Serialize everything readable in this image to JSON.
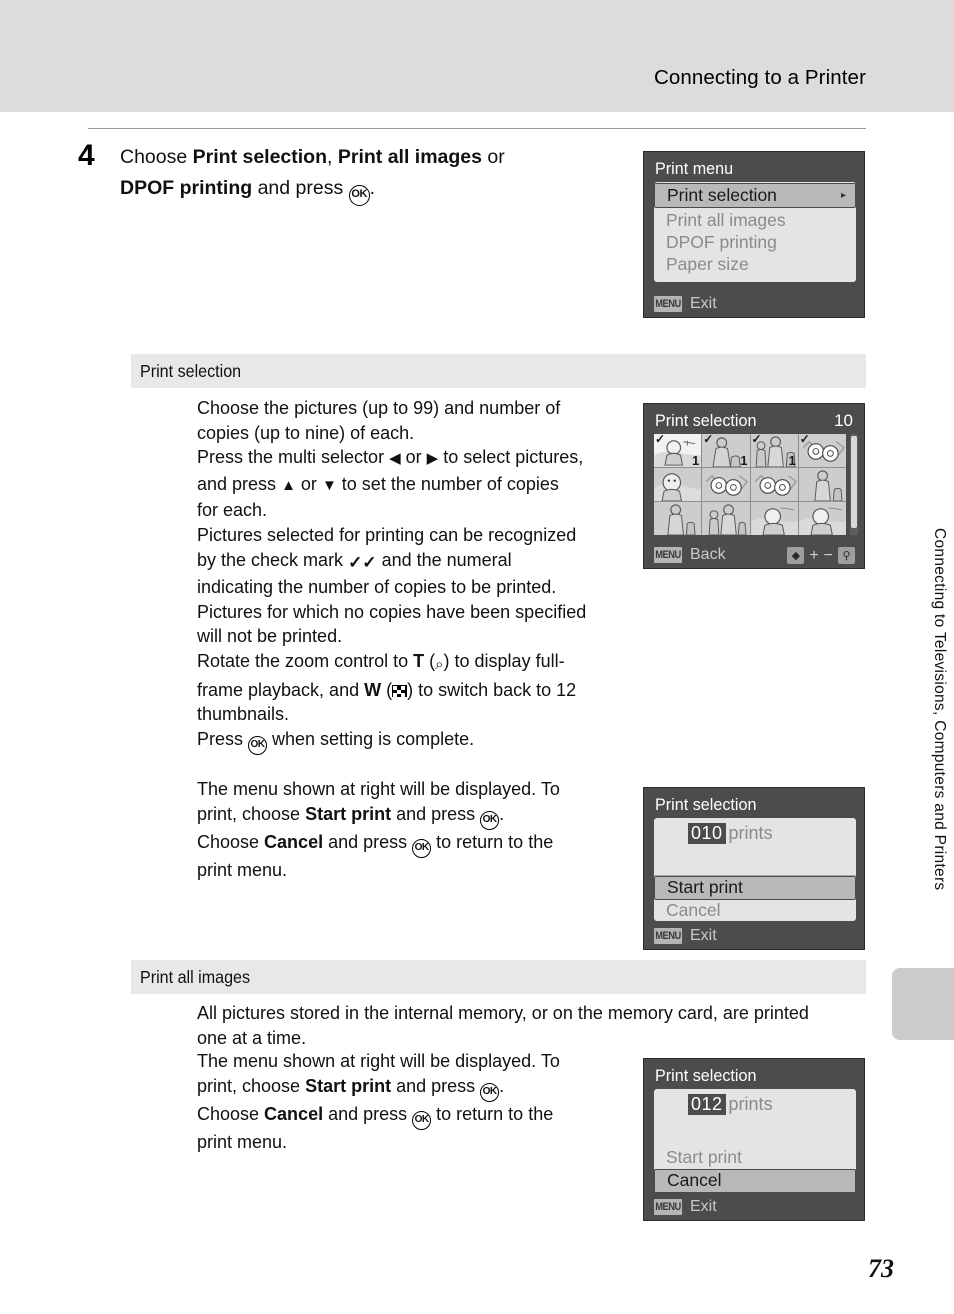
{
  "header": {
    "title": "Connecting to a Printer"
  },
  "step": {
    "number": "4",
    "line1_a": "Choose ",
    "line1_b": "Print selection",
    "line1_c": ", ",
    "line1_d": "Print all images",
    "line1_e": " or ",
    "line2_a": "DPOF printing",
    "line2_b": " and press ",
    "ok_glyph": "OK",
    "line2_c": "."
  },
  "sections": [
    {
      "heading": "Print selection"
    },
    {
      "heading": "Print all images"
    }
  ],
  "print_selection_body": {
    "p1_l1": "Choose the pictures (up to 99) and number of",
    "p1_l2": "copies (up to nine) of each.",
    "p2_l1_a": "Press the multi selector ",
    "p2_left": "◀",
    "p2_l1_b": " or ",
    "p2_right": "▶",
    "p2_l1_c": " to select pictures,",
    "p2_l2_a": "and press ",
    "p2_up": "▲",
    "p2_l2_b": " or ",
    "p2_down": "▼",
    "p2_l2_c": " to set the number of copies",
    "p2_l3": "for each.",
    "p3_l1": "Pictures selected for printing can be recognized",
    "p3_l2_a": "by the check mark ",
    "p3_check": "✓✓",
    "p3_l2_b": " and the numeral",
    "p3_l3": "indicating the number of copies to be printed.",
    "p4_l1": "Pictures for which no copies have been specified",
    "p4_l2": "will not be printed.",
    "p5_l1_a": "Rotate the zoom control to ",
    "p5_T": "T",
    "p5_l1_b": " (",
    "p5_mag": "⌕",
    "p5_l1_c": ") to display full-",
    "p5_l2_a": "frame playback, and ",
    "p5_W": "W",
    "p5_l2_b": " (",
    "p5_l2_c": ") to switch back to 12",
    "p5_l3": "thumbnails.",
    "p6_a": "Press ",
    "p6_ok": "OK",
    "p6_b": " when setting is complete.",
    "p7_l1": "The menu shown at right will be displayed. To",
    "p7_l2_a": "print, choose ",
    "p7_start": "Start print",
    "p7_l2_b": " and press ",
    "p7_ok1": "OK",
    "p7_l2_c": ".",
    "p7_l3_a": "Choose ",
    "p7_cancel": "Cancel",
    "p7_l3_b": " and press ",
    "p7_ok2": "OK",
    "p7_l3_c": " to return to the",
    "p7_l4": "print menu."
  },
  "print_all_body": {
    "p1_l1": "All pictures stored in the internal memory, or on the memory card, are printed",
    "p1_l2": "one at a time.",
    "p2_l1": "The menu shown at right will be displayed. To",
    "p2_l2_a": "print, choose ",
    "p2_start": "Start print",
    "p2_l2_b": " and press ",
    "p2_ok1": "OK",
    "p2_l2_c": ".",
    "p2_l3_a": "Choose ",
    "p2_cancel": "Cancel",
    "p2_l3_b": " and press ",
    "p2_ok2": "OK",
    "p2_l3_c": " to return to the",
    "p2_l4": "print menu."
  },
  "screens": {
    "print_menu": {
      "title": "Print menu",
      "items": [
        {
          "label": "Print selection",
          "selected": true,
          "arrow": "▸"
        },
        {
          "label": "Print all images",
          "selected": false
        },
        {
          "label": "DPOF printing",
          "selected": false
        },
        {
          "label": "Paper size",
          "selected": false
        }
      ],
      "menu_badge": "MENU",
      "foot_label": "Exit"
    },
    "print_selection_grid": {
      "title": "Print selection",
      "count": "10",
      "menu_badge": "MENU",
      "foot_label": "Back",
      "tools": [
        "updown",
        "+",
        "−",
        "magnifier"
      ],
      "thumbnails": [
        {
          "kind": "person-helicopter",
          "checked": true,
          "copies": "1",
          "active": true
        },
        {
          "kind": "two-people",
          "checked": true,
          "copies": "1",
          "active": false
        },
        {
          "kind": "family",
          "checked": true,
          "copies": "1",
          "active": false
        },
        {
          "kind": "flowers",
          "checked": true,
          "copies": "",
          "active": false
        },
        {
          "kind": "portrait",
          "checked": false,
          "copies": "",
          "active": false
        },
        {
          "kind": "flowers",
          "checked": false,
          "copies": "",
          "active": false
        },
        {
          "kind": "flowers",
          "checked": false,
          "copies": "",
          "active": false
        },
        {
          "kind": "two-people",
          "checked": false,
          "copies": "",
          "active": false
        },
        {
          "kind": "two-people",
          "checked": false,
          "copies": "",
          "active": false
        },
        {
          "kind": "family",
          "checked": false,
          "copies": "",
          "active": false
        },
        {
          "kind": "person-helicopter",
          "checked": false,
          "copies": "",
          "active": false
        },
        {
          "kind": "person-helicopter",
          "checked": false,
          "copies": "",
          "active": false
        }
      ]
    },
    "start_print_dialog": {
      "title": "Print selection",
      "count": "010",
      "count_label": "prints",
      "items": [
        {
          "label": "Start print",
          "selected": true
        },
        {
          "label": "Cancel",
          "selected": false
        }
      ],
      "menu_badge": "MENU",
      "foot_label": "Exit"
    },
    "cancel_dialog": {
      "title": "Print selection",
      "count": "012",
      "count_label": "prints",
      "items": [
        {
          "label": "Start print",
          "selected": false
        },
        {
          "label": "Cancel",
          "selected": true
        }
      ],
      "menu_badge": "MENU",
      "foot_label": "Exit"
    }
  },
  "side_tab_text": "Connecting to Televisions, Computers and Printers",
  "page_number": "73",
  "colors": {
    "header_band": "#dcdcdc",
    "section_bar": "#e8e8e8",
    "screen_bg": "#4c4c4c",
    "panel_bg": "#e4e4e4",
    "selected_row": "#b9b9b9",
    "side_tab": "#cbcbcb"
  }
}
